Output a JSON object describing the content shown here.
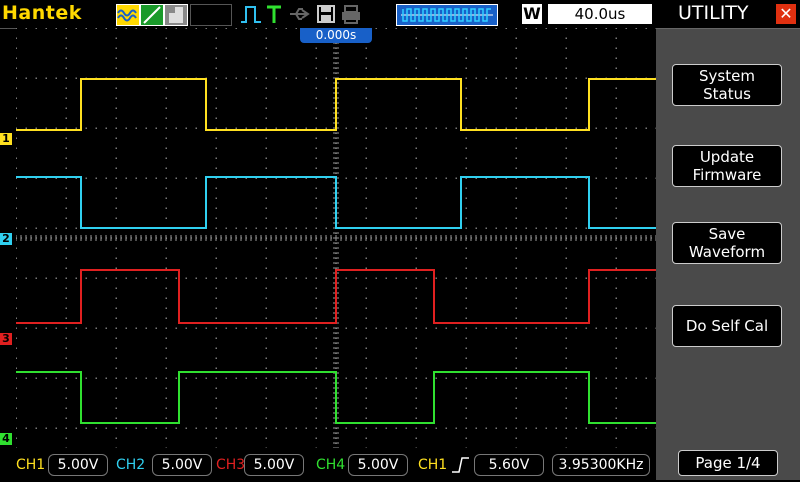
{
  "topbar": {
    "brand": "Hantek",
    "mode_badge": "W",
    "timebase": "40.0us",
    "trigger_position": "0.000s"
  },
  "colors": {
    "ch1": "#ffe020",
    "ch2": "#30d0f0",
    "ch3": "#e02020",
    "ch4": "#30e030",
    "menu_bg": "#4a4a4a",
    "accent_blue": "#1860c8"
  },
  "channels": [
    {
      "marker": "1",
      "label": "CH1",
      "scale": "5.00V"
    },
    {
      "marker": "2",
      "label": "CH2",
      "scale": "5.00V"
    },
    {
      "marker": "3",
      "label": "CH3",
      "scale": "5.00V"
    },
    {
      "marker": "4",
      "label": "CH4",
      "scale": "5.00V"
    }
  ],
  "trigger": {
    "source": "CH1",
    "slope_icon": "rising-edge-icon",
    "level": "5.60V",
    "frequency": "3.95300KHz"
  },
  "menu": {
    "title": "UTILITY",
    "buttons": [
      {
        "line1": "System",
        "line2": "Status"
      },
      {
        "line1": "Update",
        "line2": "Firmware"
      },
      {
        "line1": "Save",
        "line2": "Waveform"
      },
      {
        "line1": "Do Self Cal",
        "line2": ""
      }
    ],
    "page": "Page 1/4"
  }
}
